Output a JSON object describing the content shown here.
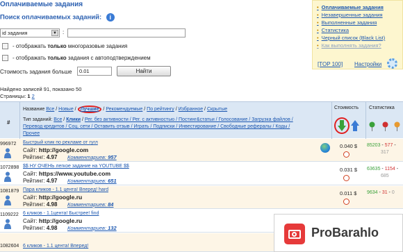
{
  "header": {
    "title": "Оплачиваемые задания",
    "search_title": "Поиск оплачиваемых заданий:",
    "help": "i"
  },
  "filters": {
    "select_value": "id задания",
    "colon": ":",
    "text_value": "",
    "checkbox1_pre": "- отображать ",
    "checkbox1_bold": "только",
    "checkbox1_post": " многоразовые задания",
    "checkbox2_pre": "- отображать ",
    "checkbox2_bold": "только",
    "checkbox2_post": " задания с автоподтверждением",
    "price_label": "Стоимость задания больше",
    "price_value": "0.01",
    "find_button": "Найти"
  },
  "sidebar": {
    "items": [
      {
        "label": "Оплачиваемые задания"
      },
      {
        "label": "Незавершенные задания"
      },
      {
        "label": "Выполненные задания"
      },
      {
        "label": "Статистика"
      },
      {
        "label": "Черный список (Black List)"
      },
      {
        "label": "Как выполнять задания?"
      }
    ],
    "top100": "[TOP 100]",
    "settings": "Настройки"
  },
  "results": {
    "found": "Найдено записей 91, показано 50",
    "pages_label": "Страницы:",
    "page1": "1",
    "page2": "2"
  },
  "table_header": {
    "num": "#",
    "name_label": "Название",
    "name_all": "Все",
    "name_new": "Новые",
    "name_best": "Лучшие",
    "name_recommended": "Рекомендуемые",
    "name_rating": "По рейтингу",
    "name_favorites": "Избранное",
    "name_hidden": "Скрытые",
    "types_label": "Тип заданий:",
    "types_all": "Все",
    "types_clicks": "Клики",
    "types_line1_rest": "Рег. без активности / Рег. с активностью / Постинг&статьи / Голосование / Загрузка файлов /",
    "types_line2": "Перевод кредитов / Соц. сети / Оставить отзыв / Играть / Подписки / Инвестирование / Свободные рефералы / Коды /",
    "types_line3": "Прочее",
    "cost": "Стоимость",
    "stats": "Статистика"
  },
  "tasks": [
    {
      "id": "996972",
      "title": "Быстрый клик по рекламе от гугл",
      "site_label": "Сайт:",
      "site": "http://google.com",
      "rating_label": "Рейтинг:",
      "rating": "4.97",
      "comments_label": "Комментариев:",
      "comments": "957",
      "price": "0.040 $",
      "ok": "85203",
      "bad": "577",
      "pending": "317"
    },
    {
      "id": "1072898",
      "title": "$$               НУ ОЧЕНЬ легкое задание на YOUTUBE                     $$",
      "site_label": "Сайт:",
      "site": "https://www.youtube.com",
      "rating_label": "Рейтинг:",
      "rating": "4.97",
      "comments_label": "Комментариев:",
      "comments": "651",
      "price": "0.031 $",
      "ok": "63635",
      "bad": "1154",
      "pending": "685"
    },
    {
      "id": "1081879",
      "title": "Пара кликов - 1.1 цента! Вперед! hard",
      "site_label": "Сайт:",
      "site": "http://google.ru",
      "rating_label": "Рейтинг:",
      "rating": "4.98",
      "comments_label": "Комментариев:",
      "comments": "84",
      "price": "0.011 $",
      "ok": "9634",
      "bad": "31",
      "pending": "0"
    },
    {
      "id": "1109222",
      "title": "6 кликов - 1.1цента! Быстрее! find",
      "site_label": "Сайт:",
      "site": "http://google.ru",
      "rating_label": "Рейтинг:",
      "rating": "4.98",
      "comments_label": "Комментариев:",
      "comments": "132",
      "price": "",
      "ok": "",
      "bad": "",
      "pending": ""
    },
    {
      "id": "1082604",
      "title": "6 кликов - 1.1 цента! Вперед!",
      "site_label": "",
      "site": "",
      "rating_label": "",
      "rating": "",
      "comments_label": "",
      "comments": "",
      "price": "",
      "ok": "",
      "bad": "",
      "pending": ""
    }
  ],
  "banner": {
    "text": "ProBarahlo"
  },
  "colors": {
    "link": "#1a56b0",
    "header_bg": "#dbe7f4",
    "sidebar_bg": "#fdf6cf",
    "highlight": "#e02020",
    "green": "#3aa13a",
    "red": "#d03030"
  }
}
